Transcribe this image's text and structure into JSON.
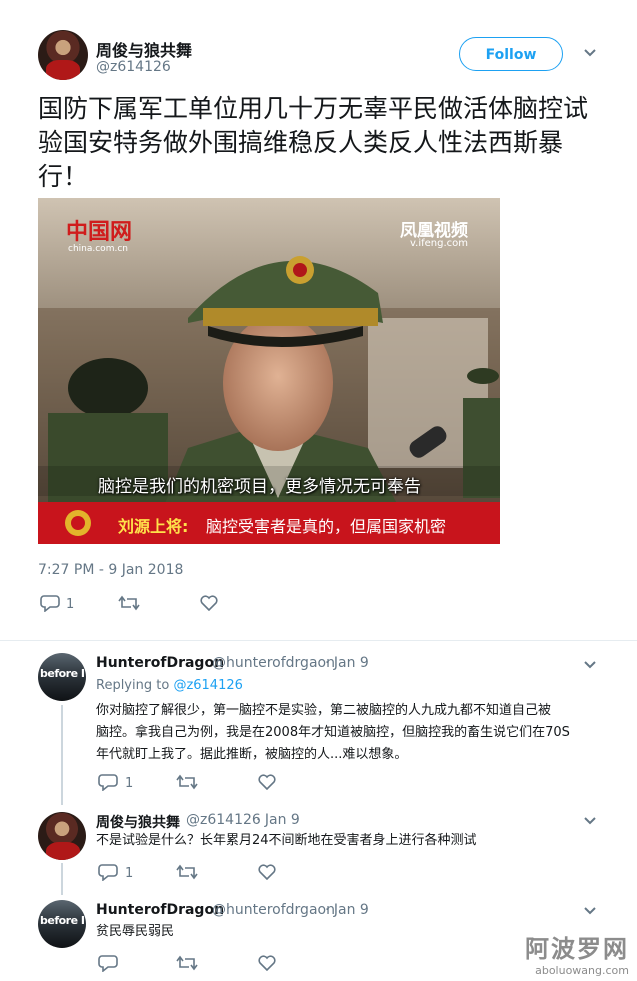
{
  "tweet": {
    "author_name": "周俊与狼共舞",
    "author_handle": "@z614126",
    "follow_label": "Follow",
    "text": "国防下属军工单位用几十万无辜平民做活体脑控试验国安特务做外围搞维稳反人类反人性法西斯暴行！",
    "timestamp": "7:27 PM - 9 Jan 2018",
    "reply_count": "1",
    "media": {
      "logo_left": "中国网",
      "logo_left_sub": "china.com.cn",
      "logo_right": "凤凰视频",
      "logo_right_sub": "v.ifeng.com",
      "subtitle": "脑控是我们的机密项目，更多情况无可奉告",
      "caption_name": "刘源上将:",
      "caption_text": "脑控受害者是真的，但属国家机密"
    }
  },
  "replies": [
    {
      "author_name": "HunterofDragon",
      "author_handle": "@hunterofdrgaon",
      "date": "· Jan 9",
      "replying_label": "Replying to",
      "replying_to": "@z614126",
      "avatar_text": "before I",
      "text_lines": [
        "你对脑控了解很少，第一脑控不是实验，第二被脑控的人九成九都不知道自己被",
        "脑控。拿我自己为例，我是在2008年才知道被脑控，但脑控我的畜生说它们在70S",
        "年代就盯上我了。据此推断，被脑控的人...难以想象。"
      ],
      "reply_count": "1"
    },
    {
      "author_name": "周俊与狼共舞",
      "author_handle": "@z614126",
      "date": "· Jan 9",
      "text_lines": [
        "不是试验是什么？长年累月24不间断地在受害者身上进行各种测试"
      ],
      "reply_count": "1"
    },
    {
      "author_name": "HunterofDragon",
      "author_handle": "@hunterofdrgaon",
      "date": "· Jan 9",
      "avatar_text": "before I",
      "text_lines": [
        "贫民辱民弱民"
      ],
      "reply_count": ""
    }
  ],
  "watermark": {
    "cn": "阿波罗网",
    "en": "aboluowang.com"
  },
  "colors": {
    "accent": "#1da1f2",
    "muted": "#657786",
    "caption_red": "#c8141c"
  },
  "icons": [
    "reply-icon",
    "retweet-icon",
    "like-icon",
    "chevron-down-icon"
  ]
}
